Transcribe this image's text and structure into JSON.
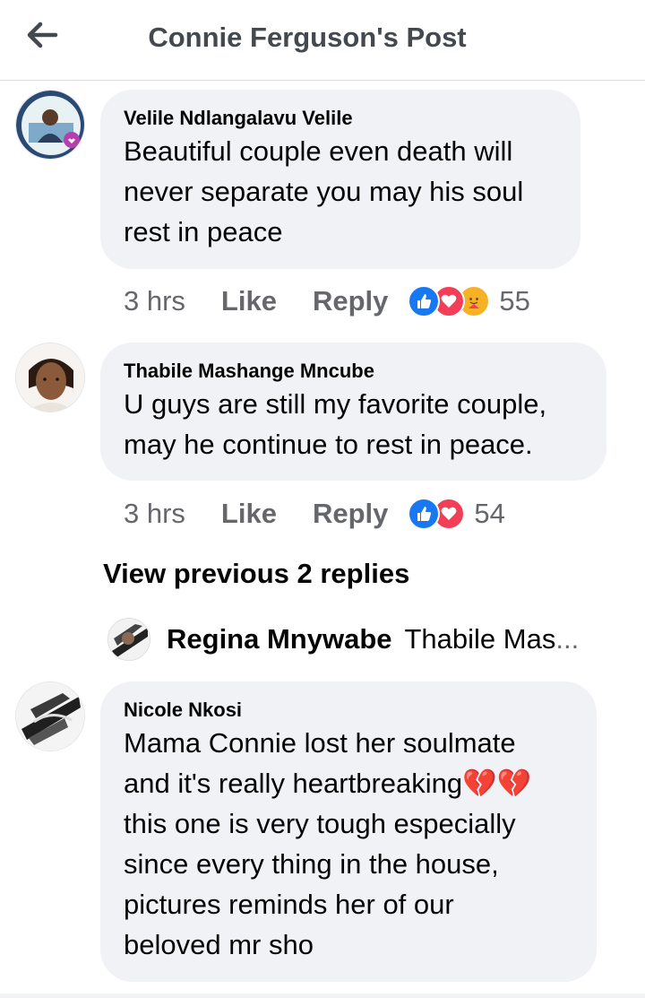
{
  "header": {
    "title": "Connie Ferguson's Post"
  },
  "comments": [
    {
      "author": "Velile Ndlangalavu Velile",
      "text_lines": [
        "Beautiful couple even death will",
        "never separate you may his soul",
        "rest in peace"
      ],
      "time": "3 hrs",
      "like_label": "Like",
      "reply_label": "Reply",
      "reaction_icons": [
        "like-reaction-icon",
        "love-reaction-icon",
        "care-reaction-icon"
      ],
      "reaction_count": "55"
    },
    {
      "author": "Thabile Mashange Mncube",
      "text_lines": [
        "U guys are still my favorite couple,",
        "may he continue to rest in peace."
      ],
      "time": "3 hrs",
      "like_label": "Like",
      "reply_label": "Reply",
      "reaction_icons": [
        "like-reaction-icon",
        "love-reaction-icon"
      ],
      "reaction_count": "54"
    },
    {
      "author": "Nicole Nkosi",
      "text_lines": [
        "Mama Connie lost her soulmate",
        "and it's really heartbreaking💔💔",
        "this one is very tough especially",
        "since every thing in the house,",
        "pictures  reminds her of our",
        "beloved mr  sho"
      ]
    }
  ],
  "view_previous": "View previous 2 replies",
  "reply_preview": {
    "author": "Regina Mnywabe",
    "text": "Thabile Mas",
    "ellipsis": "..."
  },
  "colors": {
    "like_blue": "#1877f2",
    "love_red": "#f33e58",
    "care_yellow": "#f7b125",
    "bubble": "#f0f2f5",
    "secondary_text": "#65676b"
  }
}
